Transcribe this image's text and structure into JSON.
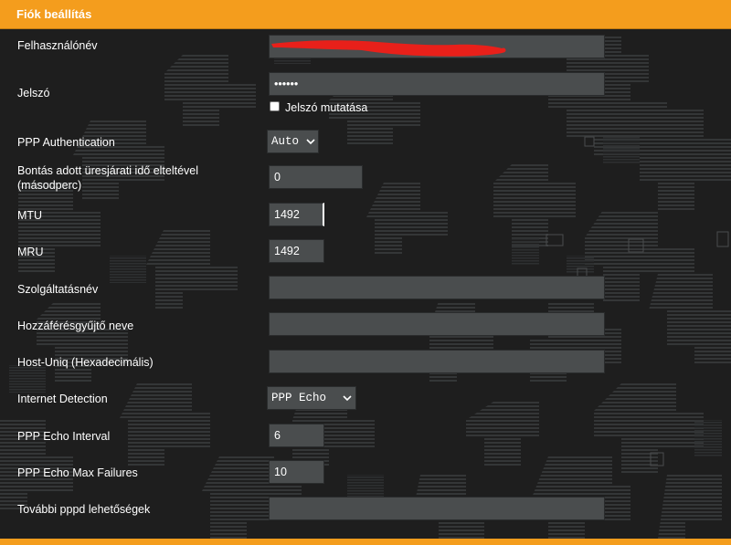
{
  "panel": {
    "title": "Fiók beállítás"
  },
  "fields": {
    "username": {
      "label": "Felhasználónév",
      "value": ""
    },
    "password": {
      "label": "Jelszó",
      "value": "••••••",
      "show_label": "Jelszó mutatása",
      "show_checked": false
    },
    "ppp_auth": {
      "label": "PPP Authentication",
      "value": "Auto"
    },
    "idle_disconnect": {
      "label_line1": "Bontás adott üresjárati idő elteltével",
      "label_line2": "(másodperc)",
      "value": "0"
    },
    "mtu": {
      "label": "MTU",
      "value": "1492"
    },
    "mru": {
      "label": "MRU",
      "value": "1492"
    },
    "service_name": {
      "label": "Szolgáltatásnév",
      "value": ""
    },
    "ac_name": {
      "label": "Hozzáférésgyűjtő neve",
      "value": ""
    },
    "host_uniq": {
      "label": "Host-Uniq (Hexadecimális)",
      "value": ""
    },
    "internet_detection": {
      "label": "Internet Detection",
      "value": "PPP Echo"
    },
    "echo_interval": {
      "label": "PPP Echo Interval",
      "value": "6"
    },
    "echo_max_failures": {
      "label": "PPP Echo Max Failures",
      "value": "10"
    },
    "pppd_options": {
      "label": "További pppd lehetőségek",
      "value": ""
    }
  },
  "icons": {
    "select_arrow": "chevron-down-icon"
  },
  "colors": {
    "accent": "#f49d1d",
    "background": "#1e1e1e",
    "input_bg": "#4a4d4e",
    "redaction": "#e8201a"
  }
}
